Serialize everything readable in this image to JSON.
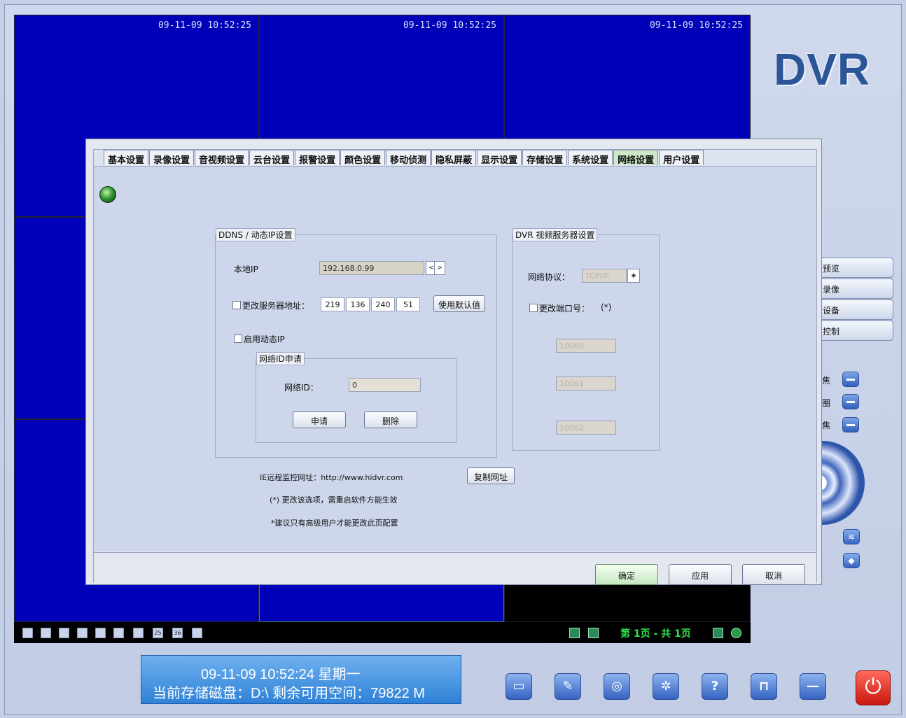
{
  "app": {
    "logo": "DVR"
  },
  "video": {
    "timestamps": [
      "09-11-09 10:52:25",
      "09-11-09 10:52:25",
      "09-11-09 10:52:25"
    ]
  },
  "dialog": {
    "tabs": [
      "基本设置",
      "录像设置",
      "音视频设置",
      "云台设置",
      "报警设置",
      "颜色设置",
      "移动侦测",
      "隐私屏蔽",
      "显示设置",
      "存储设置",
      "系统设置",
      "网络设置",
      "用户设置"
    ],
    "active_tab": "网络设置",
    "ddns": {
      "legend": "DDNS / 动态IP设置",
      "local_ip_label": "本地IP",
      "local_ip_value": "192.168.0.99",
      "nav_prev": "<",
      "nav_next": ">",
      "change_server_label": "更改服务器地址：",
      "server_octets": [
        "219",
        "136",
        "240",
        "51"
      ],
      "use_default_button": "使用默认值",
      "enable_dynamic_ip_label": "启用动态IP",
      "netid_legend": "网络ID申请",
      "netid_label": "网络ID：",
      "netid_value": "0",
      "apply_button": "申请",
      "delete_button": "删除"
    },
    "dvr_server": {
      "legend": "DVR 视频服务器设置",
      "protocol_label": "网络协议：",
      "protocol_value": "TCP/IP",
      "change_port_label": "更改端口号：",
      "change_port_note": "(*)",
      "ports": [
        "10060",
        "10061",
        "10062"
      ]
    },
    "ie_url_text": "IE远程监控网址：http://www.hidvr.com",
    "copy_url_button": "复制网址",
    "note1": "(*) 更改该选项，需重启软件方能生效",
    "note2": "*建议只有高级用户才能更改此页配置",
    "ok_button": "确定",
    "apply_button": "应用",
    "cancel_button": "取消"
  },
  "side_menu": {
    "items": [
      "预览",
      "录像",
      "设备",
      "控制"
    ],
    "controls": [
      "焦",
      "圈",
      "焦"
    ]
  },
  "pager": {
    "text": "第 1页 - 共 1页"
  },
  "layout_icons": [
    "25",
    "36"
  ],
  "status": {
    "line1": "09-11-09   10:52:24      星期一",
    "line2": "当前存储磁盘：D:\\     剩余可用空间：79822 M"
  },
  "toolbar": {
    "icons": [
      "snapshot-icon",
      "edit-icon",
      "record-icon",
      "settings-icon",
      "help-icon",
      "lock-icon",
      "minimize-icon",
      "power-icon"
    ]
  },
  "colors": {
    "video_blue": "#0000b8",
    "status_blue": "#2f82d8",
    "pager_green": "#2fe04a",
    "power_red": "#c9170f"
  }
}
